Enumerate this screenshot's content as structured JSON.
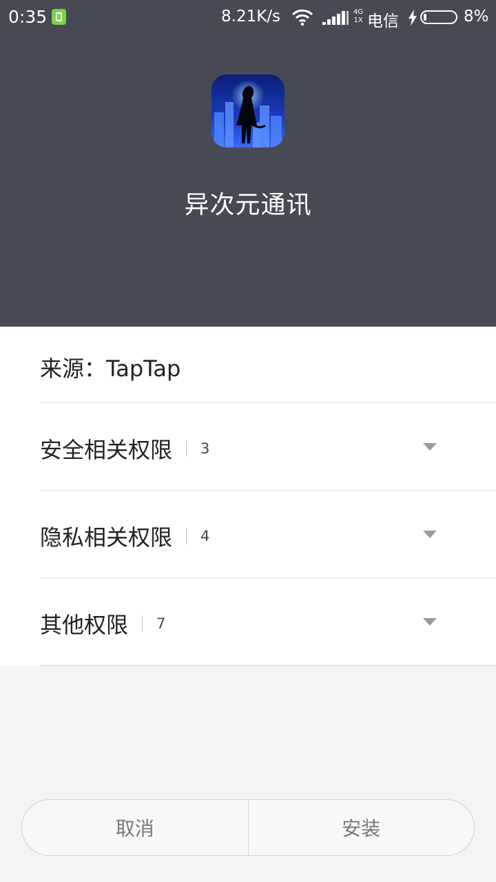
{
  "status_bar": {
    "time": "0:35",
    "speed": "8.21K/s",
    "network_top": "4G",
    "network_bottom": "1X",
    "carrier": "电信",
    "battery_percent": "8%",
    "battery_level": 0.08,
    "icons": [
      "app-notification-icon",
      "wifi-icon",
      "signal-icon",
      "charging-icon",
      "battery-icon"
    ]
  },
  "app": {
    "name": "异次元通讯",
    "icon": "app-icon"
  },
  "source": {
    "label": "来源：TapTap"
  },
  "permissions": [
    {
      "label": "安全相关权限",
      "count": "3"
    },
    {
      "label": "隐私相关权限",
      "count": "4"
    },
    {
      "label": "其他权限",
      "count": "7"
    }
  ],
  "buttons": {
    "cancel": "取消",
    "install": "安装"
  },
  "colors": {
    "header_bg": "#474a54",
    "app_notification_green": "#7bd34a",
    "panel_bg": "#ffffff",
    "page_bg": "#f4f4f4"
  }
}
